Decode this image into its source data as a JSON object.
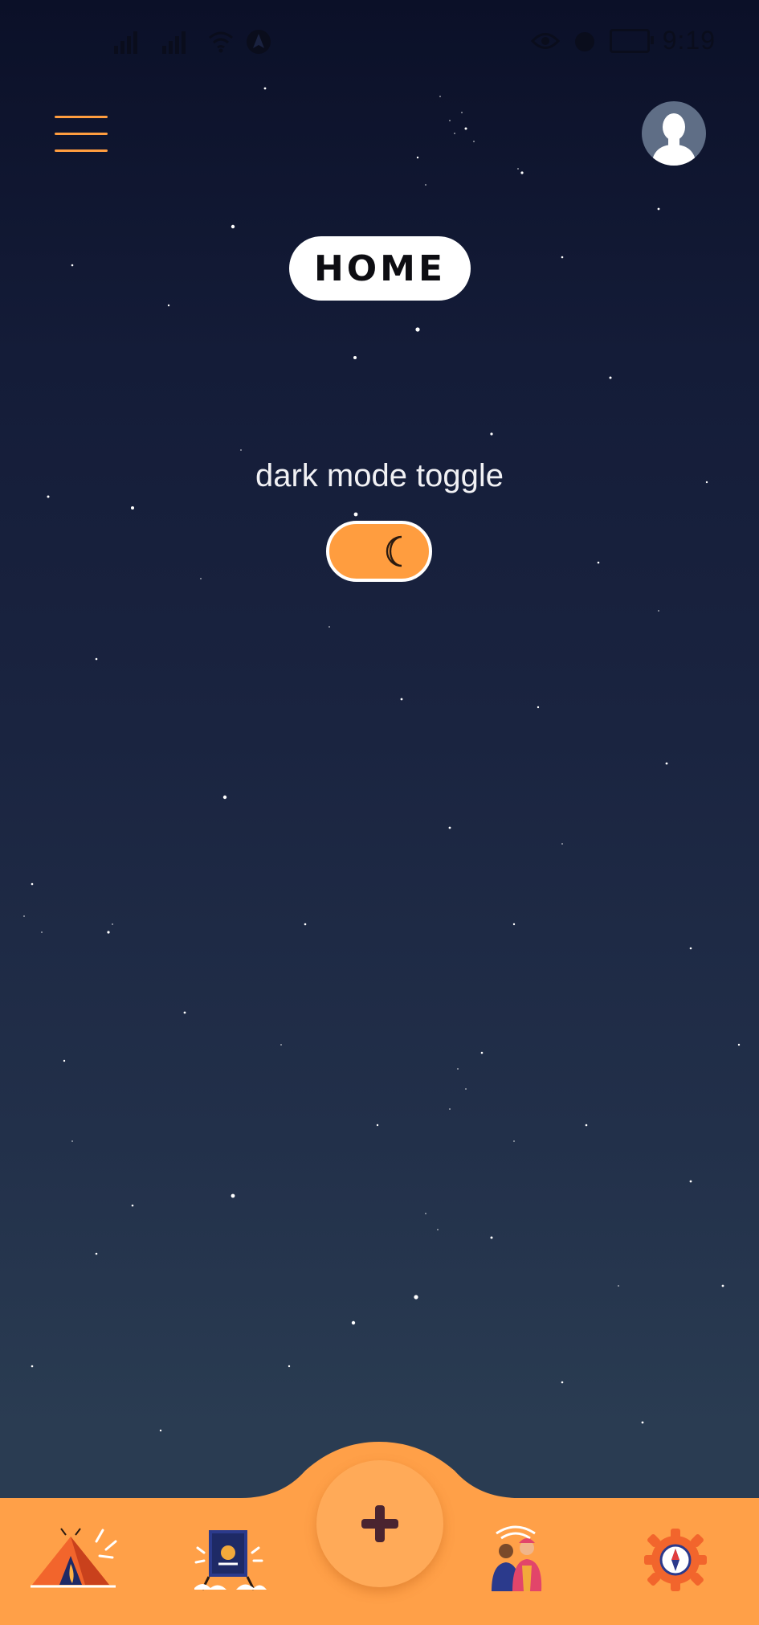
{
  "status_bar": {
    "time": "9:19",
    "left_icons": [
      "signal-icon",
      "signal-icon",
      "wifi-icon",
      "navigation-icon"
    ],
    "right_icons": [
      "eye-icon",
      "alarm-icon",
      "battery-icon"
    ],
    "battery_level": "24"
  },
  "header": {
    "menu_icon": "hamburger-menu-icon",
    "avatar_icon": "user-avatar-icon"
  },
  "page": {
    "title": "HOME",
    "toggle_label": "dark mode toggle",
    "dark_mode_on": true,
    "toggle_icon": "moon-icon"
  },
  "bottom_nav": {
    "items": [
      {
        "icon": "camping-tent-icon"
      },
      {
        "icon": "bonfire-board-icon"
      },
      {
        "icon": "add-icon"
      },
      {
        "icon": "friends-group-icon"
      },
      {
        "icon": "settings-compass-icon"
      }
    ]
  },
  "colors": {
    "accent": "#ff9d3f",
    "fab": "#ffaa58",
    "plus": "#4a2430",
    "sky_top": "#0b1028",
    "sky_bottom": "#2b3d52"
  }
}
